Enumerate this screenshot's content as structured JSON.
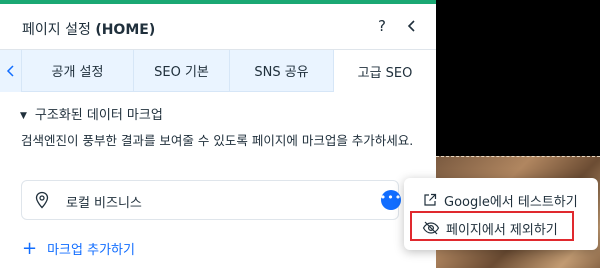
{
  "panel": {
    "title_prefix": "페이지 설정",
    "title_page": "(HOME)",
    "help_label": "?"
  },
  "tabs": [
    {
      "label": "공개 설정"
    },
    {
      "label": "SEO 기본"
    },
    {
      "label": "SNS 공유"
    },
    {
      "label": "고급 SEO"
    }
  ],
  "active_tab": "고급 SEO",
  "section": {
    "heading": "구조화된 데이터 마크업",
    "description": "검색엔진이 풍부한 결과를 보여줄 수 있도록 페이지에 마크업을 추가하세요.",
    "item_label": "로컬 비즈니스",
    "add_label": "마크업 추가하기"
  },
  "context_menu": {
    "test_label": "Google에서 테스트하기",
    "exclude_label": "페이지에서 제외하기"
  },
  "colors": {
    "accent": "#116dff",
    "top_bar": "#1aa873",
    "highlight": "#e0292e"
  }
}
